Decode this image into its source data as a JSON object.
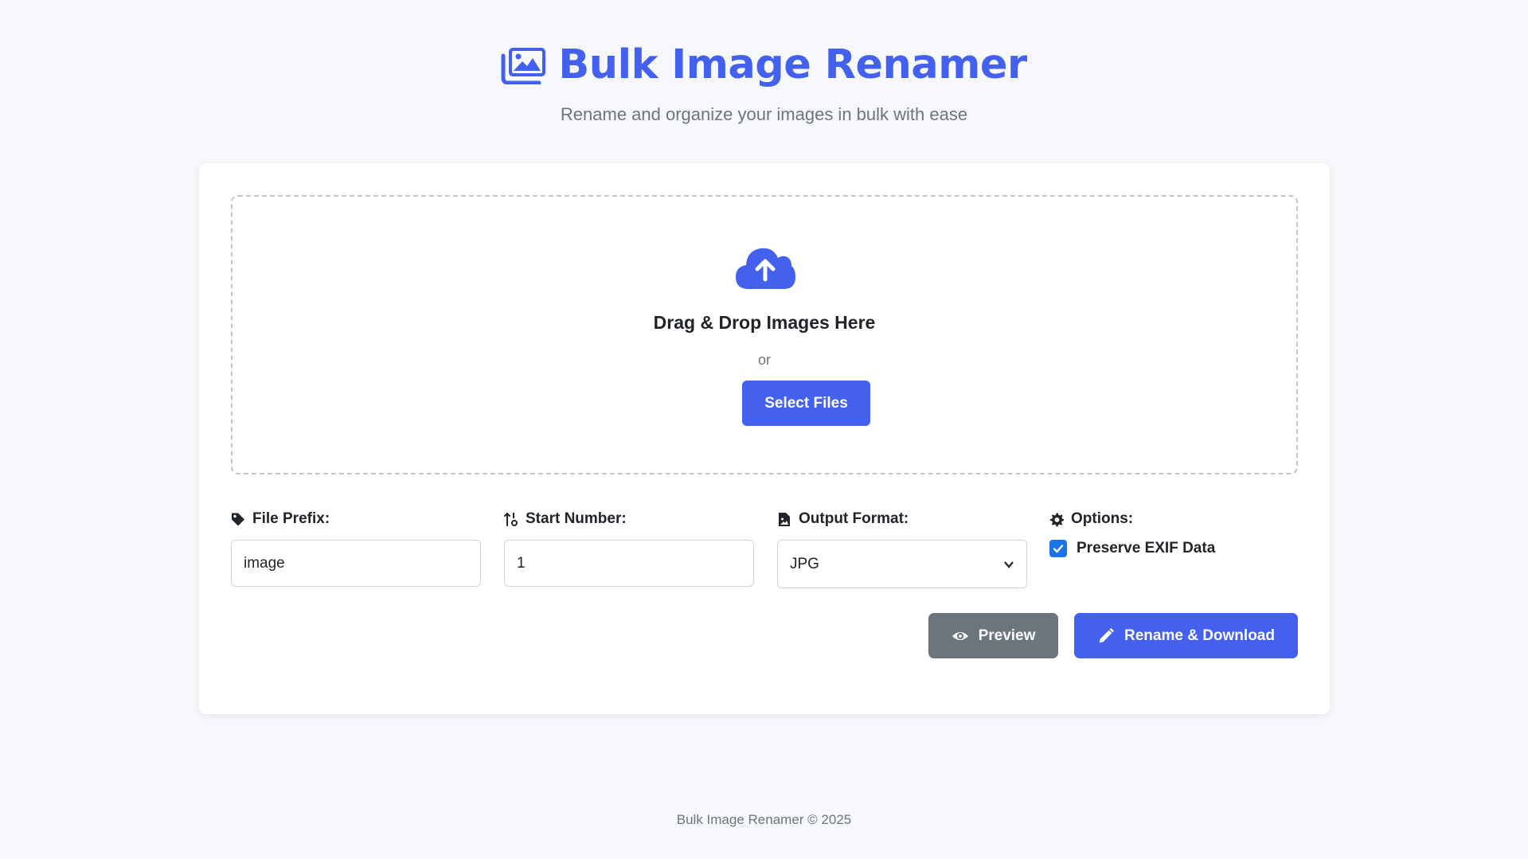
{
  "header": {
    "title": "Bulk Image Renamer",
    "subtitle": "Rename and organize your images in bulk with ease",
    "icon": "images-icon"
  },
  "dropzone": {
    "icon": "cloud-upload-icon",
    "title": "Drag & Drop Images Here",
    "or_text": "or",
    "select_label": "Select Files"
  },
  "fields": {
    "prefix": {
      "label": "File Prefix:",
      "value": "image",
      "icon": "tag-icon"
    },
    "start": {
      "label": "Start Number:",
      "value": "1",
      "icon": "sort-numeric-icon"
    },
    "format": {
      "label": "Output Format:",
      "value": "JPG",
      "icon": "file-image-icon"
    },
    "options": {
      "label": "Options:",
      "icon": "gear-icon",
      "preserve_exif_label": "Preserve EXIF Data",
      "preserve_exif_checked": true
    }
  },
  "actions": {
    "preview_label": "Preview",
    "rename_label": "Rename & Download"
  },
  "footer": {
    "text": "Bulk Image Renamer © 2025"
  },
  "colors": {
    "accent": "#4361ee",
    "secondary": "#6c757d",
    "checkbox": "#1a73e8",
    "background": "#f7f8fb"
  }
}
